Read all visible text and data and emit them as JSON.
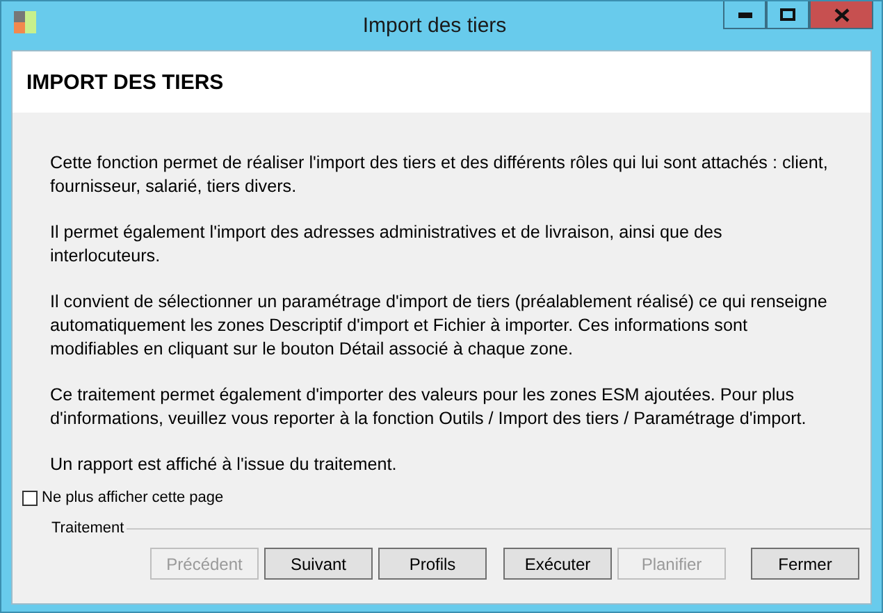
{
  "window": {
    "title": "Import des tiers"
  },
  "header": {
    "title": "IMPORT DES TIERS"
  },
  "paragraphs": [
    "Cette fonction permet de réaliser l'import des tiers et des différents rôles qui lui sont attachés : client, fournisseur, salarié, tiers divers.",
    "Il permet également l'import des adresses administratives et de livraison, ainsi que des interlocuteurs.",
    "Il convient de sélectionner un paramétrage d'import de tiers (préalablement réalisé) ce qui renseigne automatiquement les zones Descriptif d'import et Fichier à importer. Ces informations sont modifiables en cliquant sur le bouton Détail associé à chaque zone.",
    "Ce traitement permet également d'importer des valeurs pour les zones ESM ajoutées. Pour plus d'informations, veuillez vous reporter à la fonction Outils / Import des tiers / Paramétrage d'import.",
    "Un rapport est affiché à l'issue du traitement."
  ],
  "dont_show_again": {
    "label": "Ne plus afficher cette page",
    "checked": false
  },
  "group": {
    "label": "Traitement"
  },
  "buttons": [
    {
      "label": "Précédent",
      "disabled": true
    },
    {
      "label": "Suivant",
      "disabled": false
    },
    {
      "label": "Profils",
      "disabled": false
    },
    {
      "label": "Exécuter",
      "disabled": false
    },
    {
      "label": "Planifier",
      "disabled": true
    },
    {
      "label": "Fermer",
      "disabled": false
    }
  ]
}
